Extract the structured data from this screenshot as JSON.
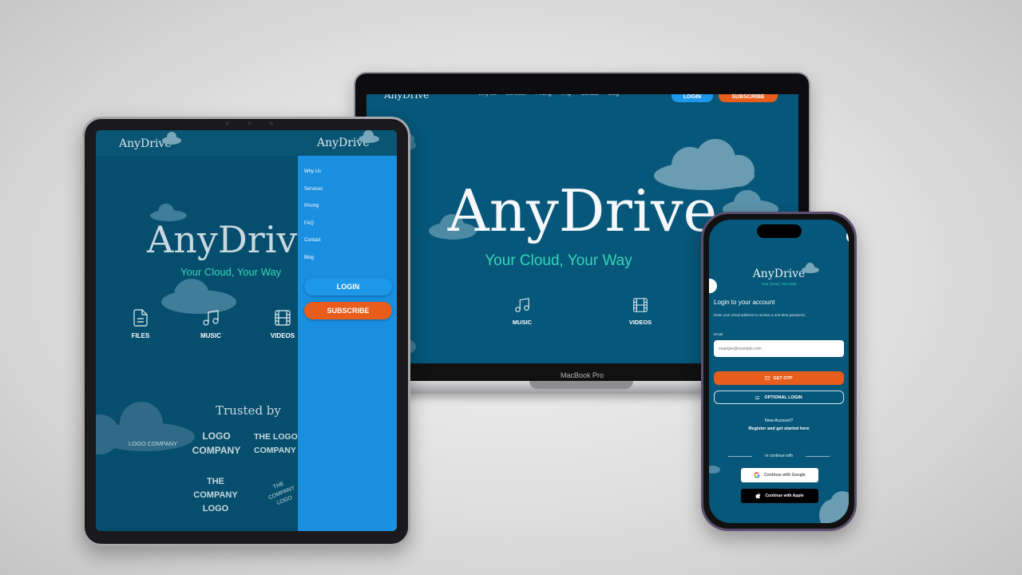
{
  "brand": "AnyDrive",
  "tagline": "Your Cloud, Your Way",
  "nav": [
    "Why Us",
    "Services",
    "Pricing",
    "FAQ",
    "Contact",
    "Blog"
  ],
  "buttons": {
    "login": "LOGIN",
    "subscribe": "SUBSCRIBE"
  },
  "features": {
    "files": "FILES",
    "music": "MUSIC",
    "videos": "VIDEOS"
  },
  "laptop_label": "MacBook Pro",
  "trusted": {
    "title": "Trusted by",
    "logos": [
      "LOGO COMPANY",
      "LOGO COMPANY",
      "THE LOGO COMPANY",
      "THE COMPANY LOGO",
      "THE COMPANY LOGO"
    ]
  },
  "login": {
    "title": "Login to your account",
    "subtitle": "Enter your email address to receive a one-time password.",
    "email_label": "Email",
    "email_placeholder": "example@example.com",
    "get_otp": "GET OTP",
    "optional_login": "OPTIONAL LOGIN",
    "new_account": "New Account?",
    "register": "Register and get started here",
    "continue_with": "or continue with",
    "google": "Continue with Google",
    "apple": "Continue with Apple"
  },
  "colors": {
    "background": "#06577a",
    "sidebar": "#1a8fe0",
    "login_button": "#1d98e8",
    "subscribe_button": "#e85d1c",
    "tagline": "#35d6b6",
    "cloud": "#4d8aa4"
  },
  "icons": [
    "file-icon",
    "music-icon",
    "video-icon",
    "mail-icon",
    "keypad-icon",
    "google-icon",
    "apple-icon"
  ]
}
